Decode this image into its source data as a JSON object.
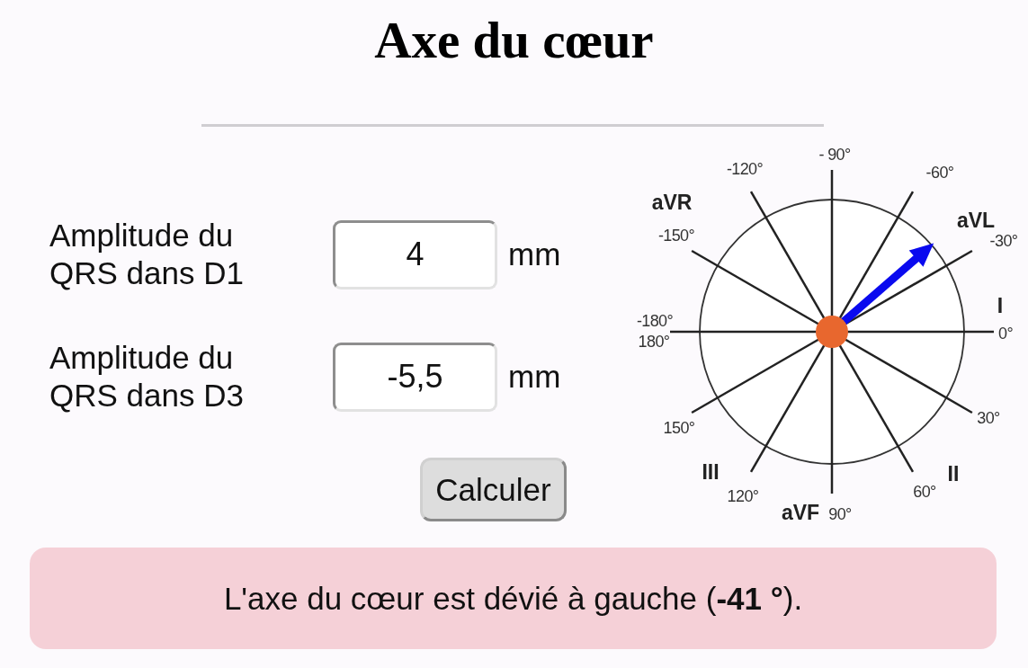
{
  "title": "Axe du cœur",
  "fields": [
    {
      "label": "Amplitude du QRS dans D1",
      "value": "4",
      "unit": "mm"
    },
    {
      "label": "Amplitude du QRS dans D3",
      "value": "-5,5",
      "unit": "mm"
    }
  ],
  "button": "Calculer",
  "axis_diagram": {
    "spokes": [
      {
        "angle_labels": [
          "0°"
        ],
        "lead": "I"
      },
      {
        "angle_labels": [
          "30°"
        ]
      },
      {
        "angle_labels": [
          "60°"
        ],
        "lead": "II"
      },
      {
        "angle_labels": [
          "90°"
        ],
        "lead": "aVF"
      },
      {
        "angle_labels": [
          "120°"
        ],
        "lead": "III"
      },
      {
        "angle_labels": [
          "150°"
        ]
      },
      {
        "angle_labels": [
          "-180°",
          "180°"
        ]
      },
      {
        "angle_labels": [
          "-150°"
        ],
        "lead": "aVR"
      },
      {
        "angle_labels": [
          "-120°"
        ]
      },
      {
        "angle_labels": [
          "- 90°"
        ]
      },
      {
        "angle_labels": [
          "-60°"
        ]
      },
      {
        "angle_labels": [
          "-30°"
        ],
        "lead": "aVL"
      }
    ]
  },
  "result": "L'axe du cœur est dévié à gauche (**-41 °**)."
}
